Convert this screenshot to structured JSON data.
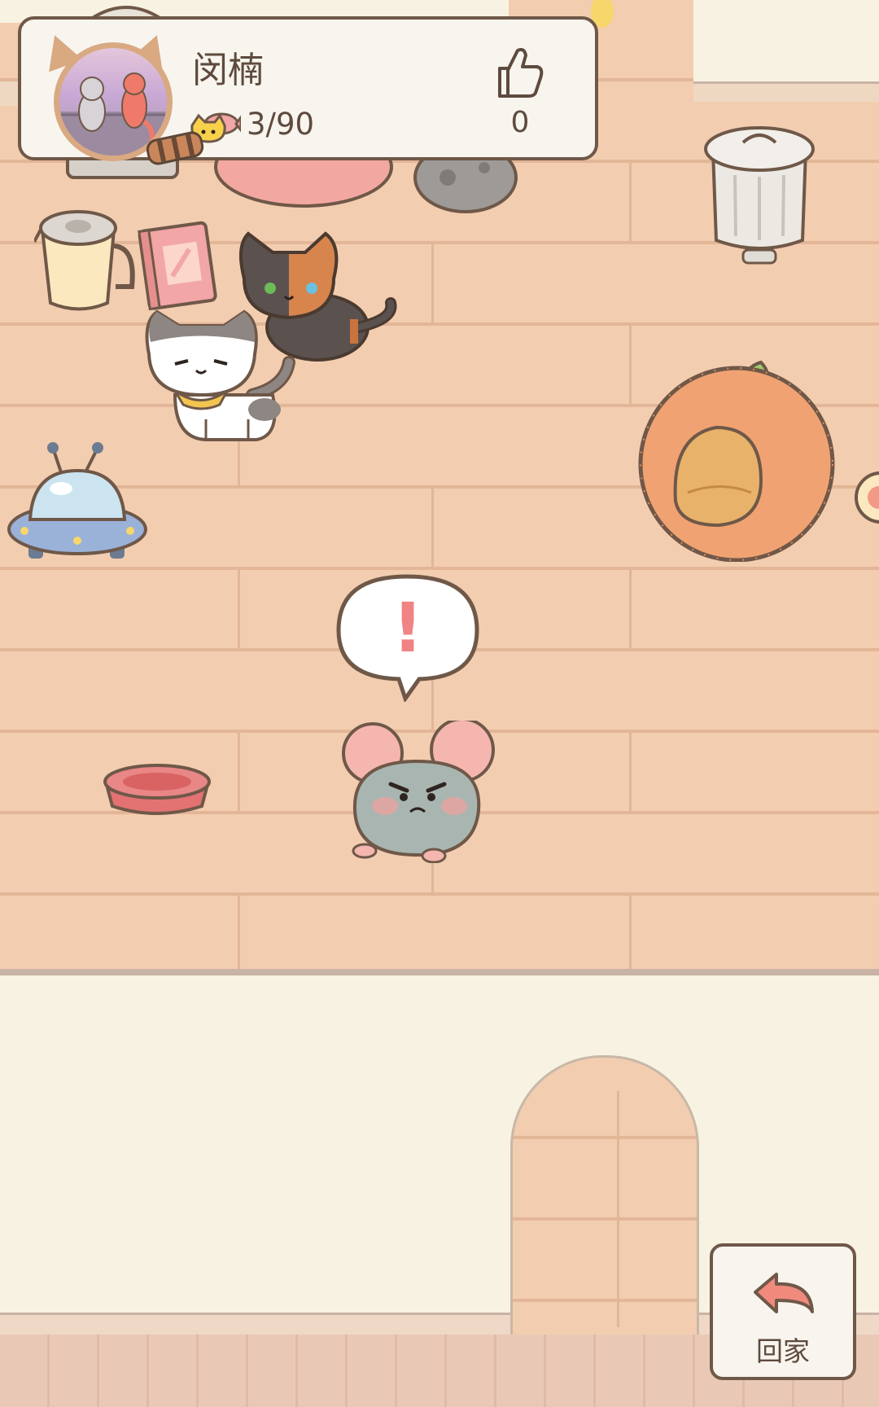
{
  "profile": {
    "name": "闵楠",
    "fish_count": "3/90",
    "like_count": "0"
  },
  "home_button": {
    "label": "回家"
  },
  "alert_mark": "!",
  "icons": {
    "like": "thumbs-up-icon",
    "fish": "fish-food-icon",
    "home": "back-arrow-icon"
  },
  "colors": {
    "floor": "#f3cdb0",
    "wall": "#f8f2e2",
    "card_border": "#6f5848",
    "text": "#5e4a3e",
    "arrow": "#ef8a7c",
    "alert": "#f08383"
  }
}
